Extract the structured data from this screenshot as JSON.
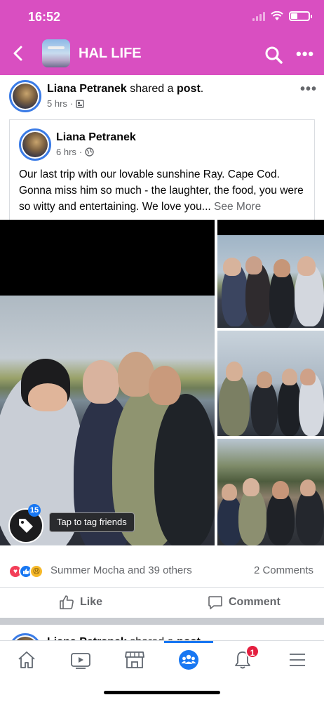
{
  "status_bar": {
    "time": "16:52"
  },
  "header": {
    "group_title": "HAL LIFE",
    "bg_color": "#d94fc1"
  },
  "share": {
    "author": "Liana Petranek",
    "verb": "shared a",
    "object": "post",
    "period": ".",
    "time": "5 hrs",
    "audience_icon": "group-members-icon"
  },
  "original_post": {
    "author": "Liana Petranek",
    "time": "6 hrs",
    "audience_icon": "globe-icon",
    "text": "Our last trip with our lovable sunshine Ray. Cape Cod. Gonna miss him so much - the laughter, the food, you were  so witty and entertaining. We love you... ",
    "see_more": "See More"
  },
  "photos": {
    "tag_count": "15",
    "tag_tip": "Tap to tag friends"
  },
  "reactions": {
    "icons": [
      "love-reaction-icon",
      "like-reaction-icon",
      "sad-reaction-icon"
    ],
    "summary": "Summer Mocha and 39 others",
    "comments": "2 Comments"
  },
  "actions": {
    "like": "Like",
    "comment": "Comment"
  },
  "next_post": {
    "author": "Liana Petranek",
    "verb": "shared a",
    "object": "post"
  },
  "tabbar": {
    "items": [
      "home-icon",
      "watch-icon",
      "marketplace-icon",
      "groups-icon",
      "notifications-icon",
      "menu-icon"
    ],
    "notification_count": "1",
    "active_color": "#1877f2"
  }
}
